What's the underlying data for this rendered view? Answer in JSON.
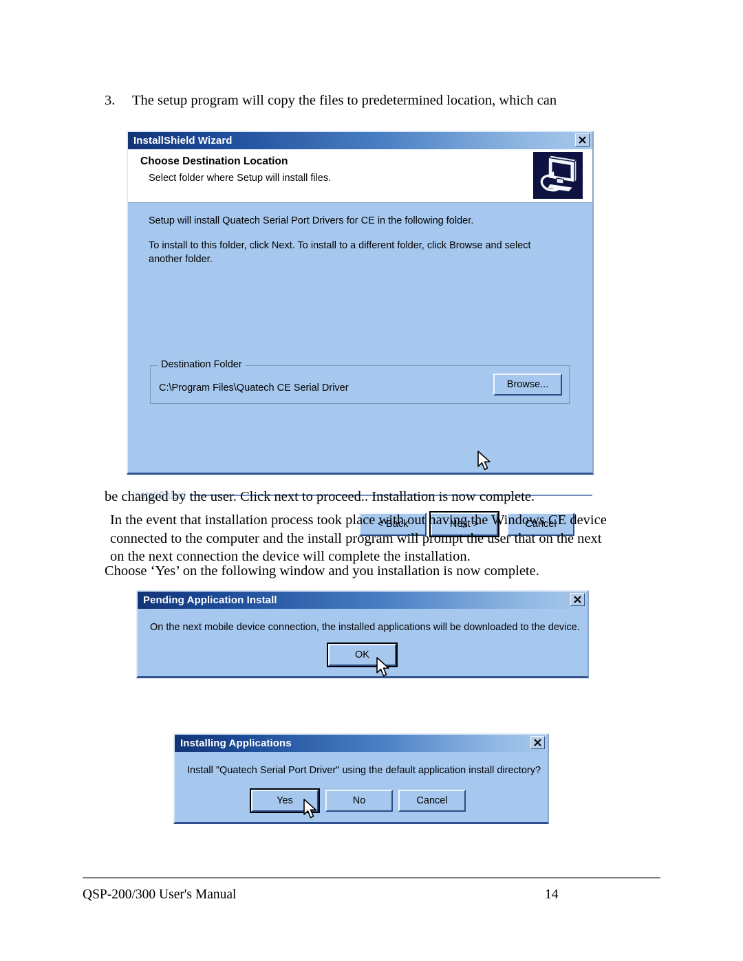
{
  "document": {
    "step_number": "3.",
    "step_text": "The setup program will copy the files to predetermined location, which can",
    "paragraph_a": "be changed by the user. Click next to proceed.. Installation is now complete.",
    "paragraph_b": "In the event that installation process took place with out having the Windows CE device connected to the computer and the install program will prompt the user that on the next on the next connection the device will complete the installation.",
    "paragraph_c": "Choose ‘Yes’ on the following window and you installation is now complete.",
    "footer_left": "QSP-200/300 User's Manual",
    "footer_page": "14"
  },
  "wizard": {
    "title": "InstallShield Wizard",
    "close_label": "✕",
    "heading": "Choose Destination Location",
    "subheading": "Select folder where Setup will install files.",
    "icon_name": "computer-install-icon",
    "body_line_1": "Setup will install Quatech Serial Port Drivers for CE in the following folder.",
    "body_line_2": "To install to this folder, click Next. To install to a different folder, click Browse and select another folder.",
    "group_legend": "Destination Folder",
    "destination_path": "C:\\Program Files\\Quatech CE Serial Driver",
    "browse_label": "Browse...",
    "brand_label": "InstallShield",
    "back_label": "< Back",
    "next_label": "Next >",
    "cancel_label": "Cancel"
  },
  "pending_dialog": {
    "title": "Pending Application Install",
    "close_label": "✕",
    "message": "On the next mobile device connection, the installed applications will be downloaded to the device.",
    "ok_label": "OK"
  },
  "installing_dialog": {
    "title": "Installing Applications",
    "close_label": "✕",
    "message": "Install \"Quatech Serial Port Driver\" using the default application install directory?",
    "yes_label": "Yes",
    "no_label": "No",
    "cancel_label": "Cancel"
  },
  "colors": {
    "dialog_body": "#a7c8ee",
    "titlebar_dark": "#123476",
    "titlebar_light": "#a9c9ec",
    "header_bg": "#ffffff",
    "icon_bg": "#0d1240",
    "bottom_border": "#2f4f8f",
    "brand_text": "#cfe0f4",
    "page_bg": "#ffffff"
  }
}
